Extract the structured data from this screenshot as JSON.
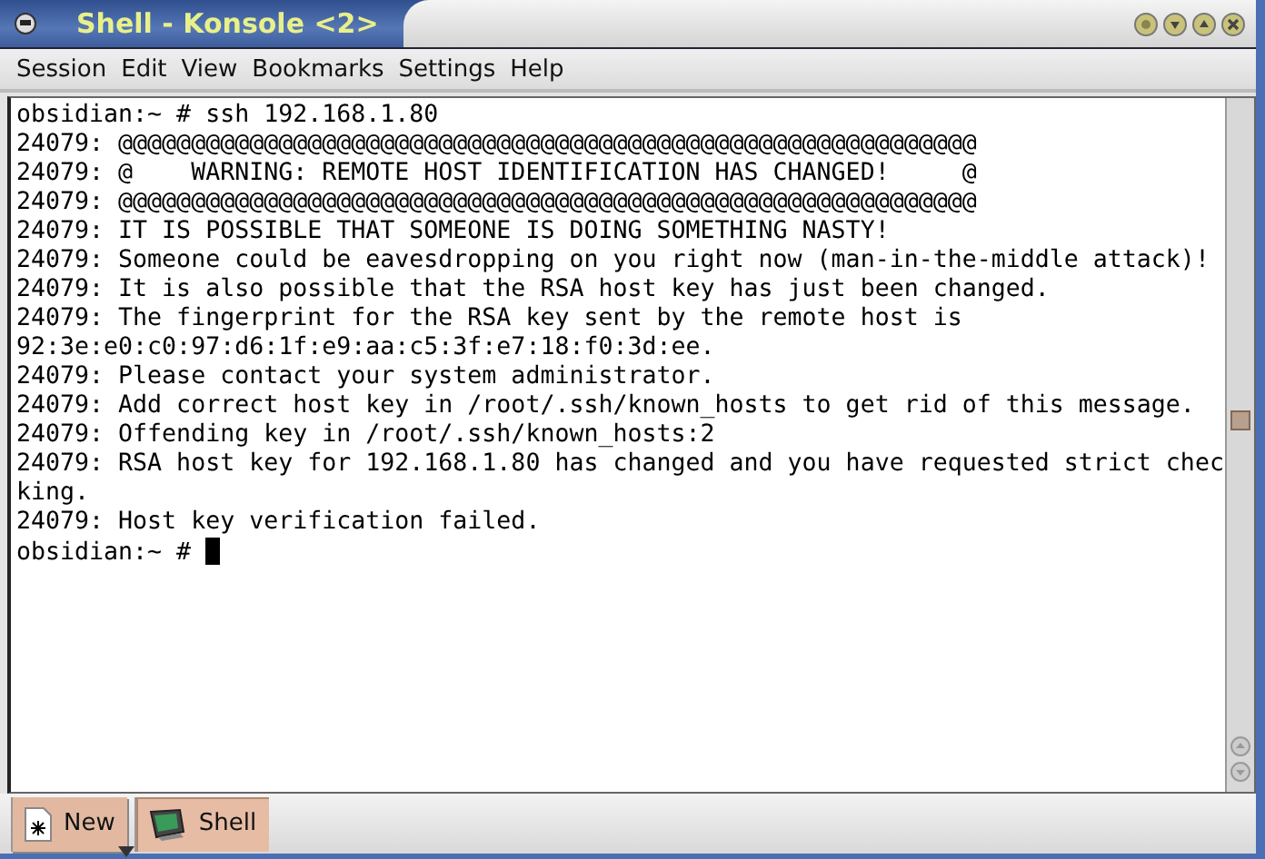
{
  "window": {
    "title": "Shell - Konsole <2>"
  },
  "menu": [
    "Session",
    "Edit",
    "View",
    "Bookmarks",
    "Settings",
    "Help"
  ],
  "terminal": {
    "lines": [
      "obsidian:~ # ssh 192.168.1.80",
      "24079: @@@@@@@@@@@@@@@@@@@@@@@@@@@@@@@@@@@@@@@@@@@@@@@@@@@@@@@@@@@",
      "24079: @    WARNING: REMOTE HOST IDENTIFICATION HAS CHANGED!     @",
      "24079: @@@@@@@@@@@@@@@@@@@@@@@@@@@@@@@@@@@@@@@@@@@@@@@@@@@@@@@@@@@",
      "24079: IT IS POSSIBLE THAT SOMEONE IS DOING SOMETHING NASTY!",
      "24079: Someone could be eavesdropping on you right now (man-in-the-middle attack)!",
      "24079: It is also possible that the RSA host key has just been changed.",
      "24079: The fingerprint for the RSA key sent by the remote host is",
      "92:3e:e0:c0:97:d6:1f:e9:aa:c5:3f:e7:18:f0:3d:ee.",
      "24079: Please contact your system administrator.",
      "24079: Add correct host key in /root/.ssh/known_hosts to get rid of this message.",
      "24079: Offending key in /root/.ssh/known_hosts:2",
      "24079: RSA host key for 192.168.1.80 has changed and you have requested strict chec",
      "king.",
      "24079: Host key verification failed."
    ],
    "prompt": "obsidian:~ # "
  },
  "session_tabs": [
    {
      "kind": "new",
      "label": "New",
      "selected": false
    },
    {
      "kind": "shell",
      "label": "Shell",
      "selected": true
    }
  ]
}
